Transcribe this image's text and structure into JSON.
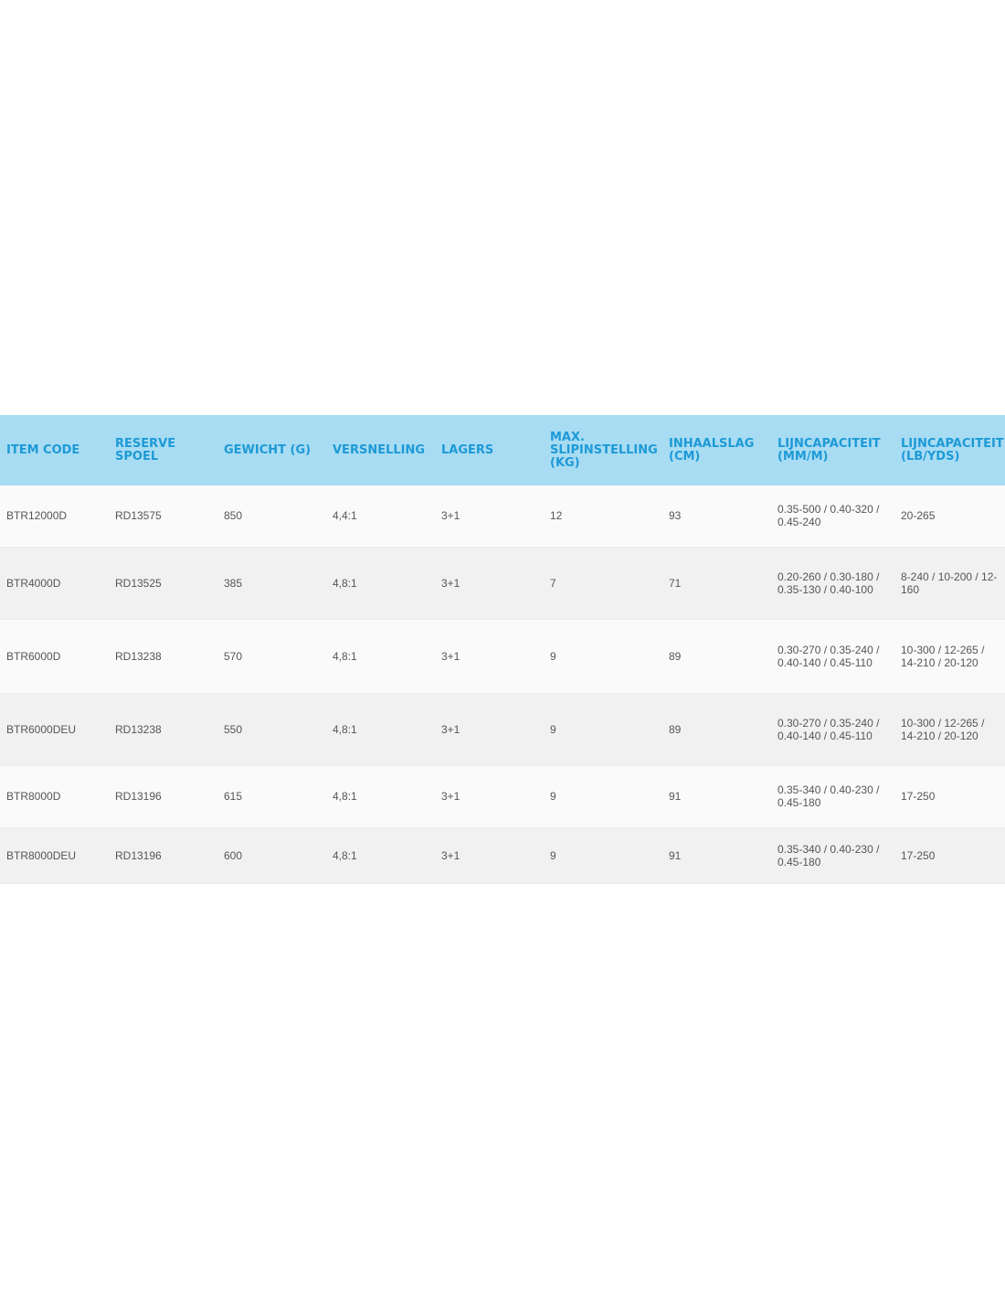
{
  "table": {
    "columns": [
      "ITEM CODE",
      "RESERVE SPOEL",
      "GEWICHT (G)",
      "VERSNELLING",
      "LAGERS",
      "MAX. SLIPINSTELLING (KG)",
      "INHAALSLAG (CM)",
      "LIJNCAPACITEIT (MM/M)",
      "LIJNCAPACITEIT (LB/YDS)"
    ],
    "rows": [
      [
        "BTR12000D",
        "RD13575",
        "850",
        "4,4:1",
        "3+1",
        "12",
        "93",
        "0.35-500 / 0.40-320 / 0.45-240",
        "20-265"
      ],
      [
        "BTR4000D",
        "RD13525",
        "385",
        "4,8:1",
        "3+1",
        "7",
        "71",
        "0.20-260 / 0.30-180 / 0.35-130 / 0.40-100",
        "8-240 / 10-200 / 12-160"
      ],
      [
        "BTR6000D",
        "RD13238",
        "570",
        "4,8:1",
        "3+1",
        "9",
        "89",
        "0.30-270 / 0.35-240 / 0.40-140 / 0.45-110",
        "10-300 / 12-265 / 14-210 / 20-120"
      ],
      [
        "BTR6000DEU",
        "RD13238",
        "550",
        "4,8:1",
        "3+1",
        "9",
        "89",
        "0.30-270 / 0.35-240 / 0.40-140 / 0.45-110",
        "10-300 / 12-265 / 14-210 / 20-120"
      ],
      [
        "BTR8000D",
        "RD13196",
        "615",
        "4,8:1",
        "3+1",
        "9",
        "91",
        "0.35-340 / 0.40-230 / 0.45-180",
        "17-250"
      ],
      [
        "BTR8000DEU",
        "RD13196",
        "600",
        "4,8:1",
        "3+1",
        "9",
        "91",
        "0.35-340 / 0.40-230 / 0.45-180",
        "17-250"
      ]
    ]
  },
  "colors": {
    "header_background": "#a8dcf3",
    "header_text": "#1d9ad6",
    "cell_text": "#555555",
    "row_light": "#fafafa",
    "row_dark": "#f1f1f1"
  }
}
